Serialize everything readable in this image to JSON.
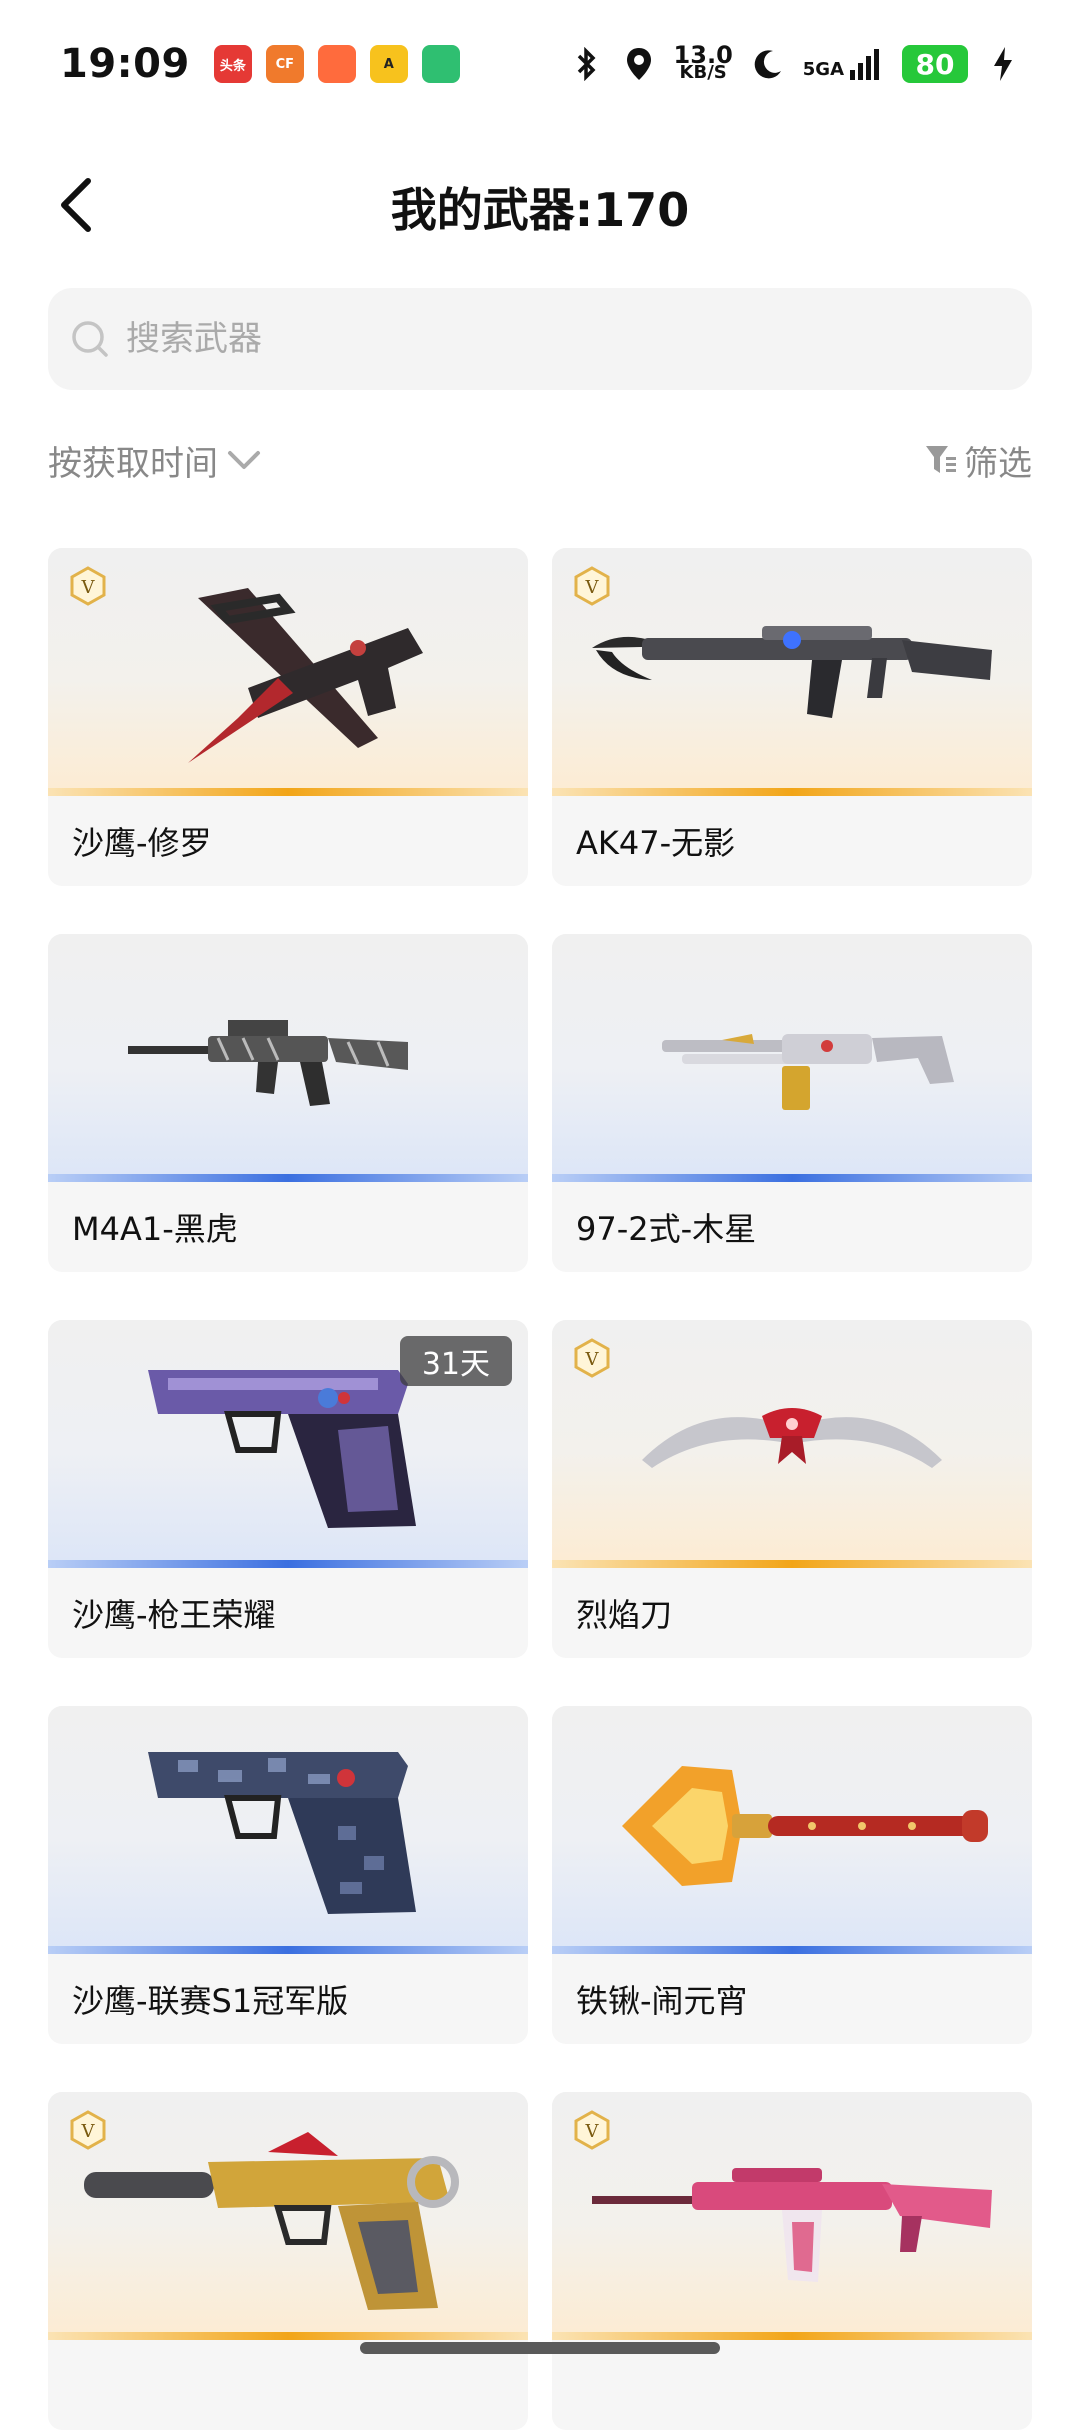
{
  "status_bar": {
    "time": "19:09",
    "speed_value": "13.0",
    "speed_unit": "KB/S",
    "network": "5GA",
    "battery": "80",
    "apps": [
      {
        "icon": "toutiao-app-icon",
        "label": "头条",
        "color": "#e53935"
      },
      {
        "icon": "cf-app-icon",
        "label": "CF",
        "color": "#f07a2c"
      },
      {
        "icon": "game-app-icon",
        "label": "",
        "color": "#ff6b3d"
      },
      {
        "icon": "a-app-icon",
        "label": "A",
        "color": "#f7c21d"
      },
      {
        "icon": "video-app-icon",
        "label": "",
        "color": "#2fbf71"
      }
    ]
  },
  "header": {
    "title": "我的武器:170"
  },
  "search": {
    "placeholder": "搜索武器"
  },
  "sort": {
    "label": "按获取时间"
  },
  "filter": {
    "label": "筛选"
  },
  "weapons": [
    {
      "name": "沙鹰-修罗",
      "tier": "gold",
      "badge": "V",
      "icon": "knife-pistol-icon"
    },
    {
      "name": "AK47-无影",
      "tier": "gold",
      "badge": "V",
      "icon": "rifle-icon"
    },
    {
      "name": "M4A1-黑虎",
      "tier": "blue",
      "badge": "",
      "icon": "rifle-icon"
    },
    {
      "name": "97-2式-木星",
      "tier": "blue",
      "badge": "",
      "icon": "shotgun-icon"
    },
    {
      "name": "沙鹰-枪王荣耀",
      "tier": "blue",
      "badge": "",
      "days": "31天",
      "icon": "pistol-icon"
    },
    {
      "name": "烈焰刀",
      "tier": "gold",
      "badge": "V",
      "icon": "blade-icon"
    },
    {
      "name": "沙鹰-联赛S1冠军版",
      "tier": "blue",
      "badge": "",
      "icon": "pistol-icon"
    },
    {
      "name": "铁锹-闹元宵",
      "tier": "blue",
      "badge": "",
      "icon": "shovel-icon"
    },
    {
      "name": "",
      "tier": "gold",
      "badge": "V",
      "icon": "pistol-icon"
    },
    {
      "name": "",
      "tier": "gold",
      "badge": "V",
      "icon": "rifle-icon"
    }
  ]
}
